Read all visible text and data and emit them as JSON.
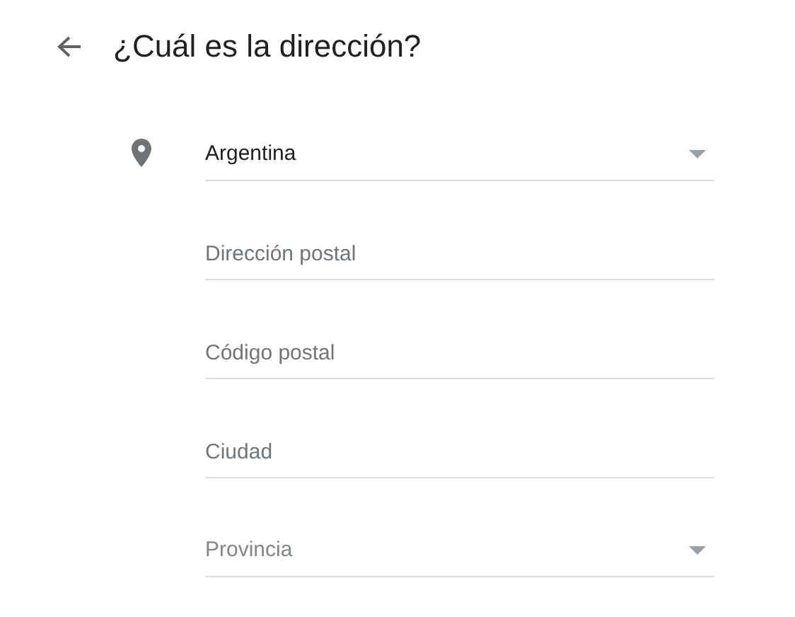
{
  "header": {
    "title": "¿Cuál es la dirección?"
  },
  "fields": [
    {
      "kind": "select",
      "value": "Argentina"
    },
    {
      "kind": "text",
      "placeholder": "Dirección postal"
    },
    {
      "kind": "text",
      "placeholder": "Código postal"
    },
    {
      "kind": "text",
      "placeholder": "Ciudad"
    },
    {
      "kind": "select",
      "placeholder": "Provincia"
    }
  ]
}
